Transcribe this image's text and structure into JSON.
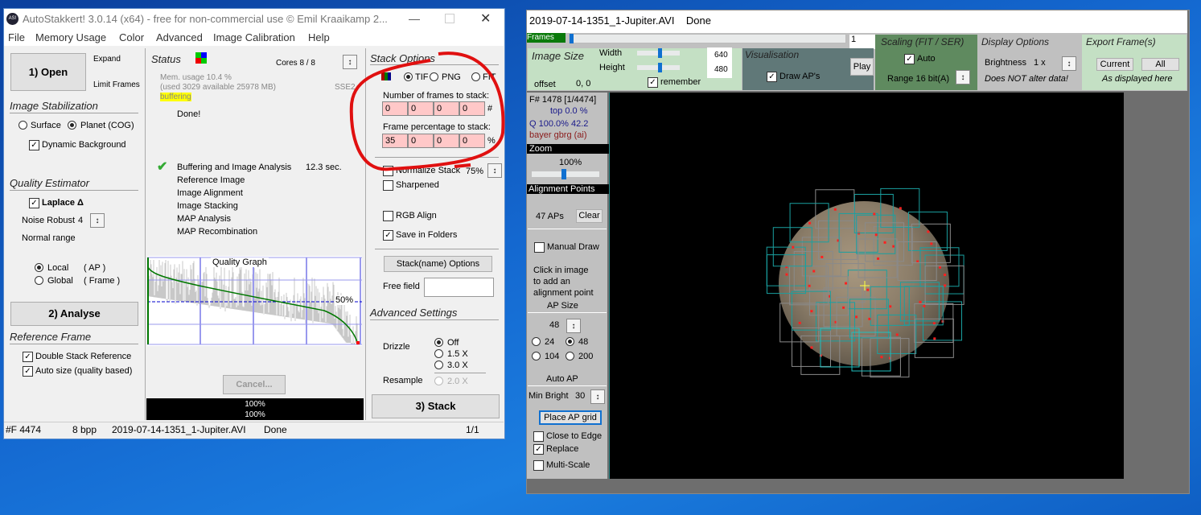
{
  "left_window": {
    "title": "AutoStakkert! 3.0.14 (x64) - free for non-commercial use © Emil Kraaikamp 2...",
    "logo": "AS!",
    "menu": [
      "File",
      "Memory Usage",
      "Color",
      "Advanced",
      "Image Calibration",
      "Help"
    ],
    "open_button": "1) Open",
    "expand": "Expand",
    "limit_frames": "Limit Frames",
    "image_stabilization": {
      "title": "Image Stabilization",
      "surface": "Surface",
      "planet": "Planet (COG)",
      "selected": "planet",
      "dynamic_background": "Dynamic Background",
      "dynamic_background_checked": true
    },
    "quality_estimator": {
      "title": "Quality Estimator",
      "laplace": "Laplace Δ",
      "laplace_checked": true,
      "noise_robust_label": "Noise Robust",
      "noise_robust_value": "4",
      "normal_range": "Normal range",
      "local": "Local",
      "local_suffix": "( AP )",
      "global": "Global",
      "global_suffix": "( Frame )",
      "selected": "local"
    },
    "analyse_button": "2) Analyse",
    "reference_frame": {
      "title": "Reference Frame",
      "double_stack": "Double Stack Reference",
      "auto_size": "Auto size (quality based)",
      "double_checked": true,
      "auto_checked": true
    },
    "status": {
      "title": "Status",
      "cores": "Cores 8 / 8",
      "mem_usage": "Mem. usage 10.4 %",
      "mem_detail": "(used 3029 available 25978 MB)",
      "sse": "SSE2",
      "buffering": "buffering",
      "done": "Done!",
      "steps": [
        {
          "label": "Buffering and Image Analysis",
          "time": "12.3 sec.",
          "done": true
        },
        {
          "label": "Reference Image"
        },
        {
          "label": "Image Alignment"
        },
        {
          "label": "Image Stacking"
        },
        {
          "label": "MAP Analysis"
        },
        {
          "label": "MAP Recombination"
        }
      ],
      "graph_title": "Quality Graph",
      "graph_marker": "50%",
      "cancel": "Cancel...",
      "progress1": "100%",
      "progress2": "100%"
    },
    "stack_options": {
      "title": "Stack Options",
      "formats": [
        "TIF",
        "PNG",
        "FIT"
      ],
      "selected": "TIF",
      "frames_label": "Number of frames to stack:",
      "frames": [
        "0",
        "0",
        "0",
        "0"
      ],
      "frames_unit": "#",
      "percent_label": "Frame percentage to stack:",
      "percents": [
        "35",
        "0",
        "0",
        "0"
      ],
      "percent_unit": "%",
      "normalize": "Normalize Stack",
      "normalize_value": "75%",
      "sharpened": "Sharpened",
      "rgb_align": "RGB Align",
      "save_folders": "Save in Folders",
      "normalize_checked": false,
      "sharpened_checked": false,
      "rgb_checked": false,
      "save_checked": true,
      "stackname_button": "Stack(name) Options",
      "free_field": "Free field",
      "free_field_value": ""
    },
    "advanced": {
      "title": "Advanced Settings",
      "drizzle": "Drizzle",
      "drizzle_options": [
        "Off",
        "1.5 X",
        "3.0 X"
      ],
      "drizzle_selected": "Off",
      "resample": "Resample",
      "resample_option": "2.0 X"
    },
    "stack_button": "3) Stack",
    "statusbar": {
      "frames": "#F 4474",
      "bpp": "8 bpp",
      "file": "2019-07-14-1351_1-Jupiter.AVI",
      "state": "Done",
      "page": "1/1"
    }
  },
  "right_window": {
    "title": "2019-07-14-1351_1-Jupiter.AVI    Done",
    "frames_label": "Frames",
    "frame_value": "1",
    "frame_slider": 0,
    "image_size": {
      "title": "Image Size",
      "width_label": "Width",
      "height_label": "Height",
      "width": "640",
      "height": "480",
      "offset_label": "offset",
      "offset": "0, 0",
      "remember": "remember",
      "remember_checked": true
    },
    "visualisation": {
      "title": "Visualisation",
      "draw_aps": "Draw AP's",
      "draw_checked": true,
      "play": "Play"
    },
    "scaling": {
      "title": "Scaling (FIT / SER)",
      "auto": "Auto",
      "auto_checked": true,
      "range": "Range 16 bit(A)"
    },
    "display": {
      "title": "Display Options",
      "brightness": "Brightness",
      "brightness_value": "1 x",
      "note": "Does NOT alter data!"
    },
    "export": {
      "title": "Export Frame(s)",
      "current": "Current",
      "all": "All",
      "note": "As displayed here"
    },
    "info": {
      "frame": "F# 1478 [1/4474]",
      "top": "top 0.0 %",
      "quality": "Q 100.0%  42.2",
      "bayer": "bayer gbrg (ai)"
    },
    "zoom": {
      "title": "Zoom",
      "value": "100%"
    },
    "ap": {
      "title": "Alignment Points",
      "count": "47 APs",
      "clear": "Clear",
      "manual_draw": "Manual Draw",
      "hint1": "Click in image",
      "hint2": "to add an",
      "hint3": "alignment point",
      "size_title": "AP Size",
      "size_value": "48",
      "sizes": [
        "24",
        "48",
        "104",
        "200"
      ],
      "size_selected": "48",
      "auto_title": "Auto AP",
      "min_bright_label": "Min Bright",
      "min_bright": "30",
      "place_grid": "Place AP grid",
      "close_edge": "Close to Edge",
      "replace": "Replace",
      "multi_scale": "Multi-Scale",
      "replace_checked": true
    },
    "colors": {
      "frames_bg": "#0a7a0a",
      "image_size_bg": "#c4e0c4",
      "visualisation_bg": "#607878",
      "scaling_bg": "#5f8a5f",
      "display_bg": "#c0c0c0",
      "export_bg": "#c4e0c4",
      "annotation": "#e01010"
    }
  }
}
